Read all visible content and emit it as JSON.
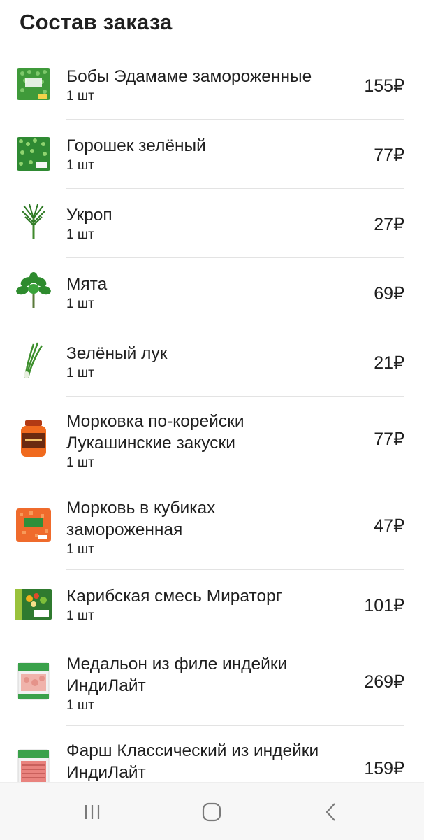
{
  "header": {
    "title": "Состав заказа"
  },
  "currency": "₽",
  "items": [
    {
      "name": "Бобы Эдамаме замороженные",
      "qty": "1 шт",
      "price": "155₽",
      "icon": "frozen-edamame-bag-icon"
    },
    {
      "name": "Горошек зелёный",
      "qty": "1 шт",
      "price": "77₽",
      "icon": "frozen-peas-bag-icon"
    },
    {
      "name": "Укроп",
      "qty": "1 шт",
      "price": "27₽",
      "icon": "dill-icon"
    },
    {
      "name": "Мята",
      "qty": "1 шт",
      "price": "69₽",
      "icon": "mint-icon"
    },
    {
      "name": "Зелёный лук",
      "qty": "1 шт",
      "price": "21₽",
      "icon": "green-onion-icon"
    },
    {
      "name": "Морковка по-корейски Лукашинские закуски",
      "qty": "1 шт",
      "price": "77₽",
      "icon": "carrot-jar-icon"
    },
    {
      "name": "Морковь в кубиках замороженная",
      "qty": "1 шт",
      "price": "47₽",
      "icon": "diced-carrot-bag-icon"
    },
    {
      "name": "Карибская смесь Мираторг",
      "qty": "1 шт",
      "price": "101₽",
      "icon": "vegetable-mix-box-icon"
    },
    {
      "name": "Медальон из филе индейки ИндиЛайт",
      "qty": "1 шт",
      "price": "269₽",
      "icon": "turkey-medallion-pack-icon"
    },
    {
      "name": "Фарш Классический из индейки ИндиЛайт",
      "qty": "",
      "price": "159₽",
      "icon": "turkey-mince-pack-icon"
    }
  ],
  "navbar": {
    "recent_icon": "recent-apps-icon",
    "home_icon": "home-icon",
    "back_icon": "back-icon"
  }
}
